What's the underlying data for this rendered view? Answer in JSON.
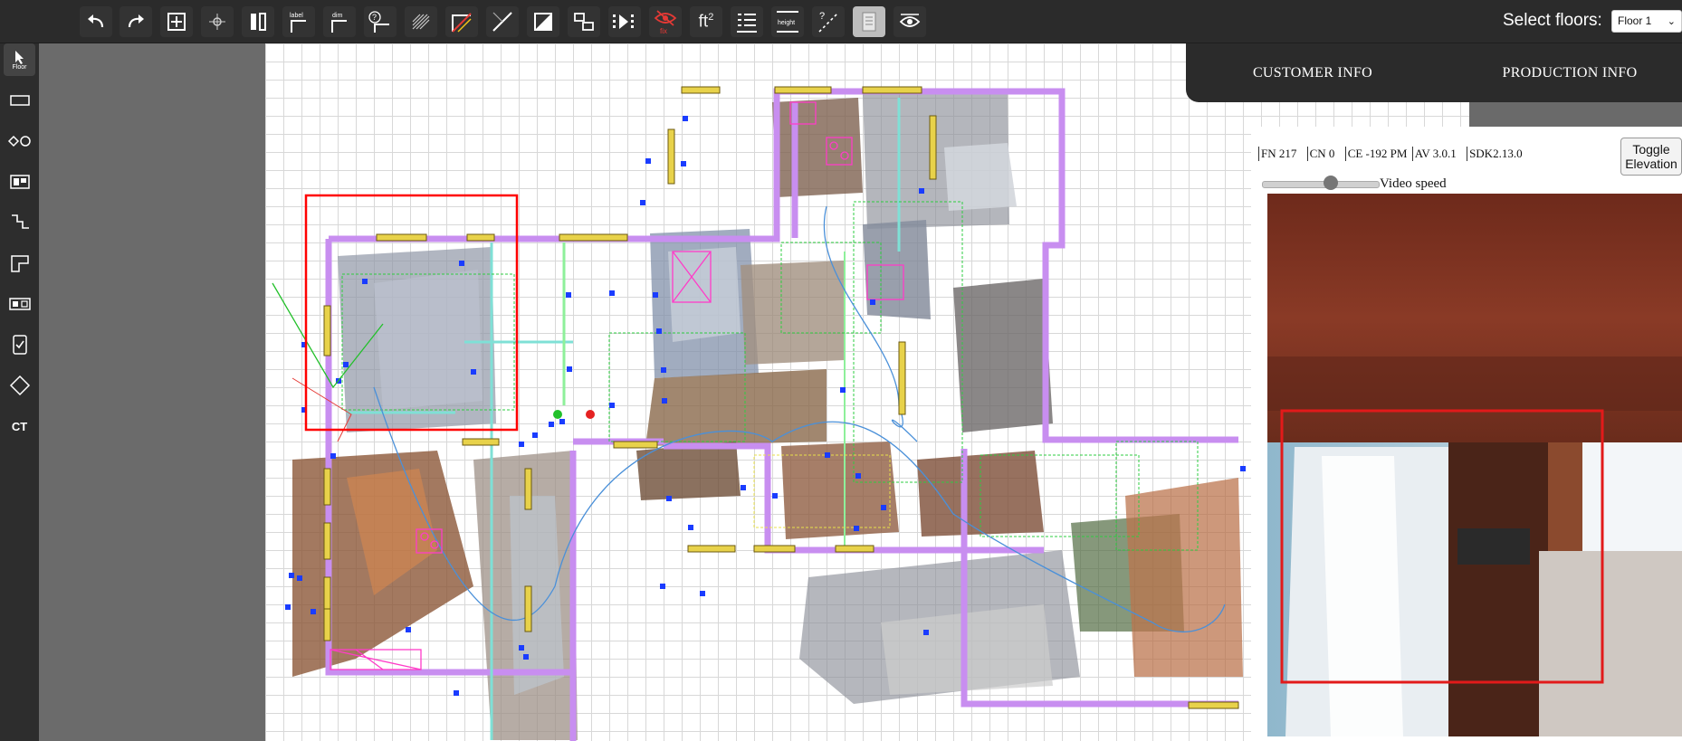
{
  "toolbar": {
    "buttons": [
      {
        "name": "undo-button",
        "icon": "undo-icon"
      },
      {
        "name": "redo-button",
        "icon": "redo-icon"
      },
      {
        "name": "fit-view-button",
        "icon": "fit-view-icon"
      },
      {
        "name": "center-button",
        "icon": "crosshair-icon"
      },
      {
        "name": "split-view-button",
        "icon": "split-view-icon"
      },
      {
        "name": "label-button",
        "icon": "label-icon",
        "text": "label"
      },
      {
        "name": "dimension-button",
        "icon": "dimension-icon",
        "text": "dim"
      },
      {
        "name": "unknown-room-button",
        "icon": "question-room-icon"
      },
      {
        "name": "hatch-button",
        "icon": "hatch-icon"
      },
      {
        "name": "slash-wall-button",
        "icon": "slash-wall-icon"
      },
      {
        "name": "diagonal-button",
        "icon": "diagonal-icon"
      },
      {
        "name": "half-fill-button",
        "icon": "half-fill-icon"
      },
      {
        "name": "rooms-button",
        "icon": "rooms-icon"
      },
      {
        "name": "play-frames-button",
        "icon": "play-frames-icon"
      },
      {
        "name": "hide-fix-button",
        "icon": "eye-slash-icon",
        "text": "fix"
      },
      {
        "name": "area-button",
        "icon": "area-icon",
        "text": "ft²"
      },
      {
        "name": "list-button",
        "icon": "list-icon"
      },
      {
        "name": "height-button",
        "icon": "height-icon",
        "text": "height"
      },
      {
        "name": "measure-button",
        "icon": "measure-icon"
      },
      {
        "name": "document-button",
        "icon": "document-icon",
        "active": true
      },
      {
        "name": "view-button",
        "icon": "eye-icon"
      }
    ],
    "floor_label": "Select floors:",
    "floor_value": "Floor 1"
  },
  "sidebar": {
    "items": [
      {
        "name": "select-tool",
        "icon": "cursor-icon",
        "text": "Floor"
      },
      {
        "name": "wall-tool",
        "icon": "wall-rectangle-icon"
      },
      {
        "name": "opening-tool",
        "icon": "diamond-circle-icon"
      },
      {
        "name": "window-tool",
        "icon": "window-icon"
      },
      {
        "name": "stairs-tool",
        "icon": "stairs-icon"
      },
      {
        "name": "shape-tool",
        "icon": "l-shape-icon"
      },
      {
        "name": "cabinet-tool",
        "icon": "cabinet-icon"
      },
      {
        "name": "checklist-tool",
        "icon": "checklist-icon"
      },
      {
        "name": "diamond-tool",
        "icon": "diamond-icon"
      },
      {
        "name": "ct-tool",
        "icon": "ct-icon",
        "text": "CT"
      }
    ]
  },
  "tabs": {
    "customer": "CUSTOMER INFO",
    "production": "PRODUCTION INFO"
  },
  "panel": {
    "stats": [
      "FN  217",
      "CN 0",
      "CE  -192",
      "PM",
      "AV  3.0.1",
      "SDK2.13.0"
    ],
    "toggle_label_1": "Toggle",
    "toggle_label_2": "Elevation",
    "video_speed_label": "Video speed",
    "video_speed": 0.6
  },
  "colors": {
    "toolbar_bg": "#2b2b2b",
    "wall": "#c88ef0",
    "selection": "#ff0000",
    "window": "#e8d24a",
    "marker": "#1a3cff"
  }
}
